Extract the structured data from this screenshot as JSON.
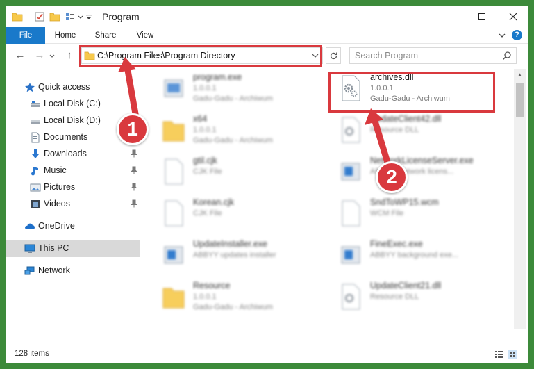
{
  "window": {
    "title": "Program",
    "controls": {
      "minimize": "minimize-icon",
      "maximize": "maximize-icon",
      "close": "close-icon"
    }
  },
  "ribbon": {
    "tabs": [
      {
        "label": "File",
        "active": true
      },
      {
        "label": "Home"
      },
      {
        "label": "Share"
      },
      {
        "label": "View"
      }
    ]
  },
  "address": {
    "path": "C:\\Program Files\\Program Directory",
    "search_placeholder": "Search Program"
  },
  "sidebar": {
    "items": [
      {
        "label": "Quick access",
        "icon": "star-icon",
        "pinned": false
      },
      {
        "label": "Local Disk (C:)",
        "icon": "drive-icon",
        "pinned": true
      },
      {
        "label": "Local Disk (D:)",
        "icon": "drive-icon",
        "pinned": true
      },
      {
        "label": "Documents",
        "icon": "documents-icon",
        "pinned": true
      },
      {
        "label": "Downloads",
        "icon": "downloads-icon",
        "pinned": true
      },
      {
        "label": "Music",
        "icon": "music-icon",
        "pinned": true
      },
      {
        "label": "Pictures",
        "icon": "pictures-icon",
        "pinned": true
      },
      {
        "label": "Videos",
        "icon": "videos-icon",
        "pinned": true
      },
      {
        "label": "OneDrive",
        "icon": "cloud-icon",
        "pinned": false
      },
      {
        "label": "This PC",
        "icon": "computer-icon",
        "pinned": false,
        "selected": true
      },
      {
        "label": "Network",
        "icon": "network-icon",
        "pinned": false
      }
    ]
  },
  "files": [
    {
      "name": "program.exe",
      "line1": "1.0.0.1",
      "line2": "Gadu-Gadu - Archiwum",
      "icon": "exe-icon",
      "blurred": true
    },
    {
      "name": "archives.dll",
      "line1": "1.0.0.1",
      "line2": "Gadu-Gadu - Archiwum",
      "icon": "dll-icon",
      "blurred": false
    },
    {
      "name": "x64",
      "line1": "1.0.0.1",
      "line2": "Gadu-Gadu - Archiwum",
      "icon": "folder-icon",
      "blurred": true
    },
    {
      "name": "UpdateClient42.dll",
      "line1": "Resource DLL",
      "line2": "",
      "icon": "dll-icon",
      "blurred": true
    },
    {
      "name": "gtil.cjk",
      "line1": "CJK File",
      "line2": "",
      "icon": "file-icon",
      "blurred": true
    },
    {
      "name": "NetworkLicenseServer.exe",
      "line1": "ABBYY Network licens...",
      "line2": "",
      "icon": "exe-icon",
      "blurred": true
    },
    {
      "name": "Korean.cjk",
      "line1": "CJK File",
      "line2": "",
      "icon": "file-icon",
      "blurred": true
    },
    {
      "name": "SndToWP15.wcm",
      "line1": "WCM File",
      "line2": "",
      "icon": "file-icon",
      "blurred": true
    },
    {
      "name": "UpdateInstaller.exe",
      "line1": "ABBYY updates installer",
      "line2": "",
      "icon": "exe-icon",
      "blurred": true
    },
    {
      "name": "FineExec.exe",
      "line1": "ABBYY background exe...",
      "line2": "",
      "icon": "exe-icon",
      "blurred": true
    },
    {
      "name": "Resource",
      "line1": "1.0.0.1",
      "line2": "Gadu-Gadu - Archiwum",
      "icon": "folder-icon",
      "blurred": true
    },
    {
      "name": "UpdateClient21.dll",
      "line1": "Resource DLL",
      "line2": "",
      "icon": "dll-icon",
      "blurred": true
    }
  ],
  "status": {
    "item_count": "128 items"
  },
  "annotations": {
    "callout_1": "1",
    "callout_2": "2",
    "highlight_color": "#d9393e"
  },
  "colors": {
    "accent": "#1979ca",
    "desktop": "#3c8a3a"
  }
}
